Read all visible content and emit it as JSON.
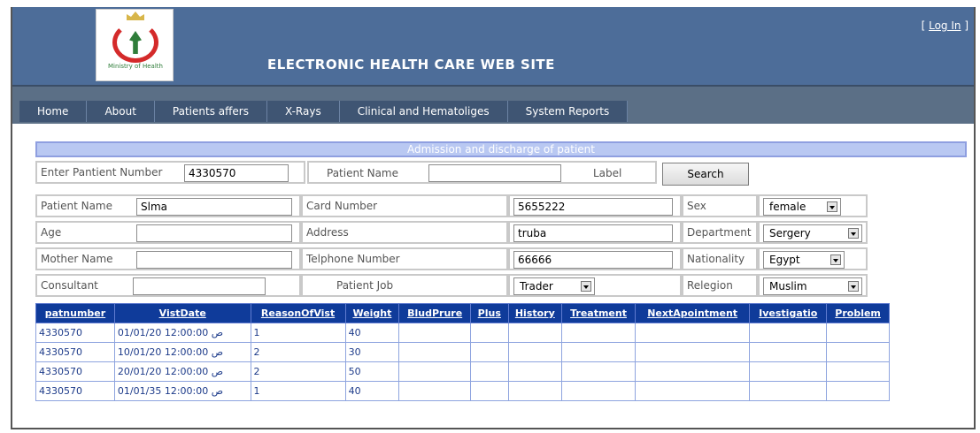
{
  "header": {
    "logo_text": "Ministry of Health",
    "site_title": "ELECTRONIC HEALTH CARE WEB SITE",
    "login_open": "[ ",
    "login_label": "Log In",
    "login_close": " ]"
  },
  "menu": {
    "items": [
      {
        "label": "Home"
      },
      {
        "label": "About"
      },
      {
        "label": "Patients affers"
      },
      {
        "label": "X-Rays"
      },
      {
        "label": "Clinical and Hematoliges"
      },
      {
        "label": "System Reports"
      }
    ]
  },
  "section_title": "Admission and discharge of patient",
  "search_row": {
    "patient_number_label": "Enter Pantient Number",
    "patient_number_value": "4330570",
    "patient_name_label": "Patient Name",
    "patient_name_value": "",
    "label_text": "Label",
    "search_button": "Search"
  },
  "form": {
    "patient_name": {
      "label": "Patient Name",
      "value": "Slma"
    },
    "card_number": {
      "label": "Card Number",
      "value": "5655222"
    },
    "sex": {
      "label": "Sex",
      "value": "female"
    },
    "age": {
      "label": "Age",
      "value": ""
    },
    "address": {
      "label": "Address",
      "value": "truba"
    },
    "department": {
      "label": "Department",
      "value": "Sergery"
    },
    "mother_name": {
      "label": "Mother Name",
      "value": ""
    },
    "telephone": {
      "label": "Telphone Number",
      "value": "66666"
    },
    "nationality": {
      "label": "Nationality",
      "value": "Egypt"
    },
    "consultant": {
      "label": "Consultant",
      "value": ""
    },
    "patient_job": {
      "label": "Patient  Job",
      "value": "Trader"
    },
    "religion": {
      "label": "Relegion",
      "value": "Muslim"
    }
  },
  "table": {
    "columns": [
      "patnumber",
      "VistDate",
      "ReasonOfVist",
      "Weight",
      "BludPrure",
      "Plus",
      "History",
      "Treatment",
      "NextApointment",
      "Ivestigatio",
      "Problem"
    ],
    "rows": [
      {
        "patnumber": "4330570",
        "VistDate": "01/01/20 12:00:00 ص",
        "ReasonOfVist": "1",
        "Weight": "40",
        "BludPrure": "",
        "Plus": "",
        "History": "",
        "Treatment": "",
        "NextApointment": "",
        "Ivestigatio": "",
        "Problem": ""
      },
      {
        "patnumber": "4330570",
        "VistDate": "10/01/20 12:00:00 ص",
        "ReasonOfVist": "2",
        "Weight": "30",
        "BludPrure": "",
        "Plus": "",
        "History": "",
        "Treatment": "",
        "NextApointment": "",
        "Ivestigatio": "",
        "Problem": ""
      },
      {
        "patnumber": "4330570",
        "VistDate": "20/01/20 12:00:00 ص",
        "ReasonOfVist": "2",
        "Weight": "50",
        "BludPrure": "",
        "Plus": "",
        "History": "",
        "Treatment": "",
        "NextApointment": "",
        "Ivestigatio": "",
        "Problem": ""
      },
      {
        "patnumber": "4330570",
        "VistDate": "01/01/35 12:00:00 ص",
        "ReasonOfVist": "1",
        "Weight": "40",
        "BludPrure": "",
        "Plus": "",
        "History": "",
        "Treatment": "",
        "NextApointment": "",
        "Ivestigatio": "",
        "Problem": ""
      }
    ]
  },
  "colors": {
    "header_bg": "#4d6d99",
    "menu_bg": "#3f5573",
    "section_band": "#b9c8f2",
    "table_header": "#0f3b9a"
  }
}
